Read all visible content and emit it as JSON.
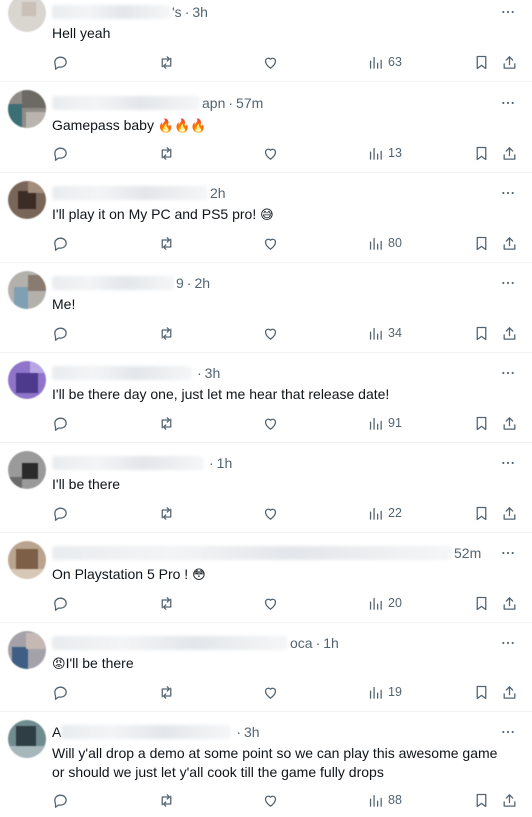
{
  "icons": {
    "reply": "reply-icon",
    "retweet": "retweet-icon",
    "like": "heart-icon",
    "views": "views-icon",
    "bookmark": "bookmark-icon",
    "share": "share-icon",
    "more": "more-icon"
  },
  "colors": {
    "muted": "#536471",
    "text": "#0f1419",
    "divider": "#eff3f4"
  },
  "replies": [
    {
      "time": "3h",
      "handle_tail": "'s",
      "text": "Hell yeah",
      "views": "63"
    },
    {
      "time": "57m",
      "handle_tail": "apn",
      "text": "Gamepass baby",
      "emoji": "🔥🔥🔥",
      "views": "13"
    },
    {
      "time": "2h",
      "handle_tail": "",
      "text": "I'll play it on My PC and PS5 pro!",
      "emoji": "😅",
      "views": "80"
    },
    {
      "time": "2h",
      "handle_tail": "9",
      "text": "Me!",
      "views": "34"
    },
    {
      "time": "3h",
      "handle_tail": "",
      "text": "I'll be there day one, just let me hear that release date!",
      "views": "91"
    },
    {
      "time": "1h",
      "handle_tail": "",
      "text": "I'll be there",
      "views": "22"
    },
    {
      "time": "52m",
      "handle_tail": "",
      "text": "On Playstation 5 Pro !",
      "emoji": "😳",
      "views": "20"
    },
    {
      "time": "1h",
      "handle_tail": "oca",
      "text": "I'll be there",
      "emoji_prefix": "😡",
      "views": "19"
    },
    {
      "time": "3h",
      "handle_tail": "A",
      "text": "Will y'all drop a demo at some point so we can play this awesome game or should we just let y'all cook till the game fully drops",
      "views": "88"
    }
  ]
}
